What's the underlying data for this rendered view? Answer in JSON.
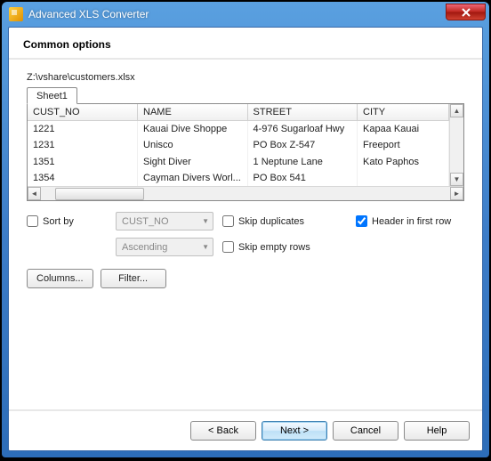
{
  "window": {
    "title": "Advanced XLS Converter"
  },
  "heading": "Common options",
  "path": "Z:\\vshare\\customers.xlsx",
  "sheets": [
    "Sheet1"
  ],
  "columns": [
    "CUST_NO",
    "NAME",
    "STREET",
    "CITY"
  ],
  "rows": [
    {
      "c0": "1221",
      "c1": "Kauai Dive Shoppe",
      "c2": "4-976 Sugarloaf Hwy",
      "c3": "Kapaa Kauai"
    },
    {
      "c0": "1231",
      "c1": "Unisco",
      "c2": "PO Box Z-547",
      "c3": "Freeport"
    },
    {
      "c0": "1351",
      "c1": "Sight Diver",
      "c2": "1 Neptune Lane",
      "c3": "Kato Paphos"
    },
    {
      "c0": "1354",
      "c1": "Cayman Divers Worl...",
      "c2": "PO Box 541",
      "c3": ""
    }
  ],
  "options": {
    "sort_by_label": "Sort by",
    "sort_field": "CUST_NO",
    "sort_dir": "Ascending",
    "skip_duplicates_label": "Skip duplicates",
    "skip_empty_label": "Skip empty rows",
    "header_first_label": "Header in first row",
    "header_first_checked": true
  },
  "buttons": {
    "columns": "Columns...",
    "filter": "Filter...",
    "back": "< Back",
    "next": "Next >",
    "cancel": "Cancel",
    "help": "Help"
  }
}
